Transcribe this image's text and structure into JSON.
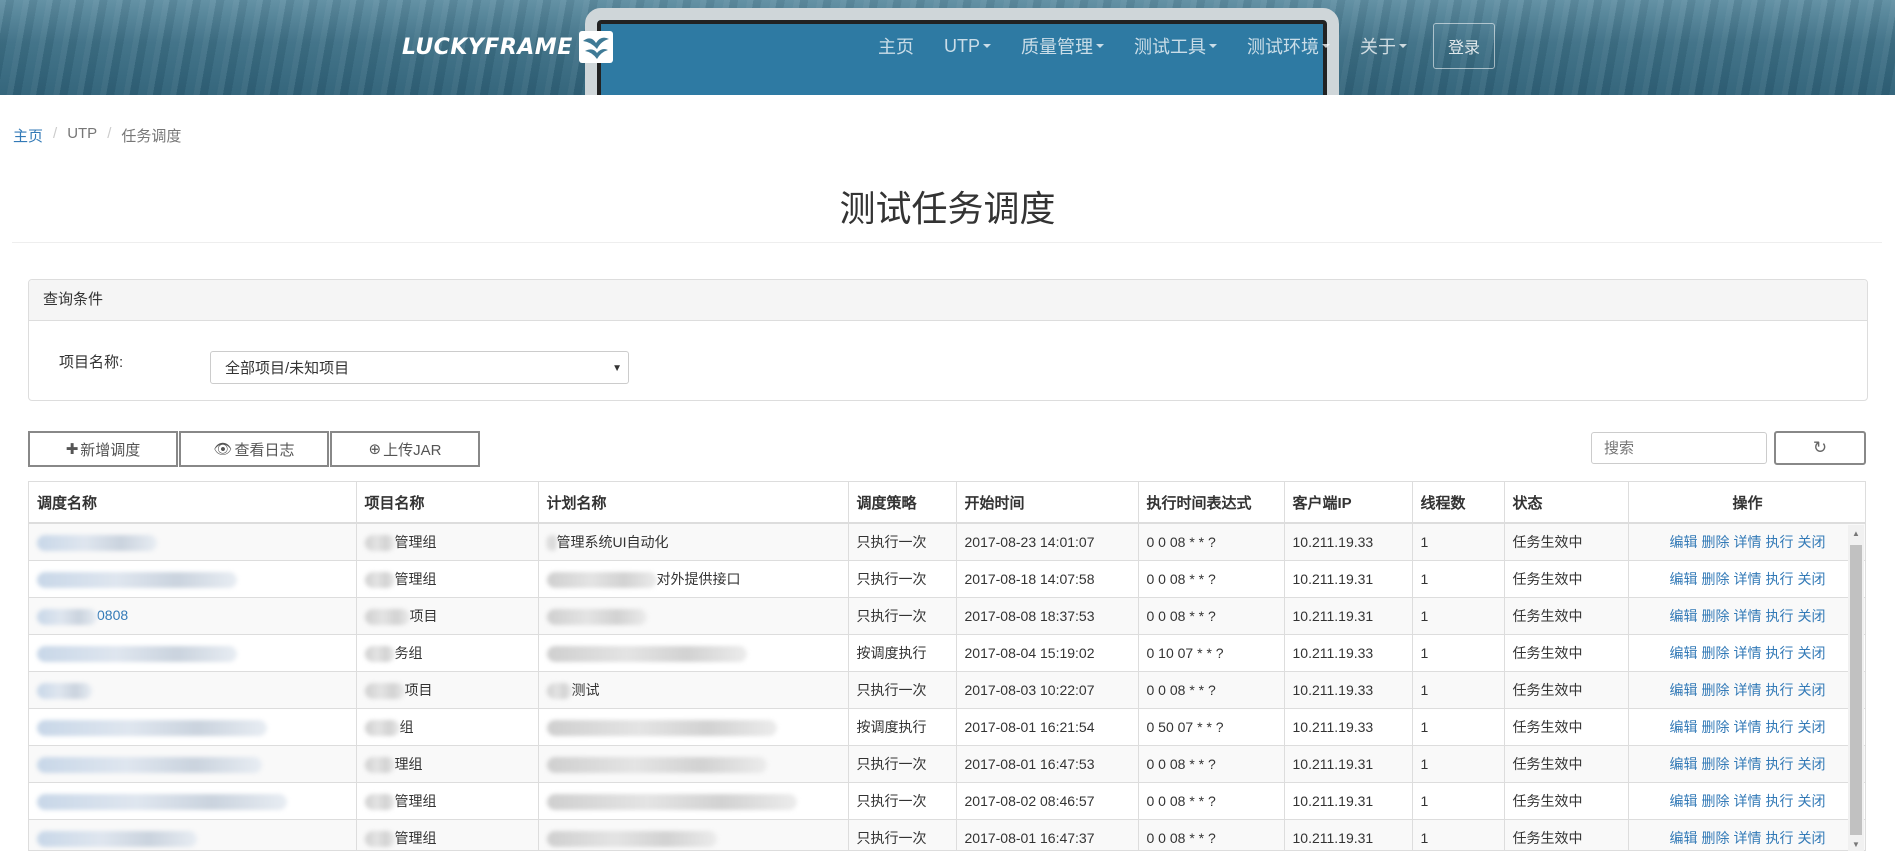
{
  "header": {
    "logo_text": "LUCKYFRAME",
    "nav": [
      {
        "label": "主页",
        "dropdown": false
      },
      {
        "label": "UTP",
        "dropdown": true
      },
      {
        "label": "质量管理",
        "dropdown": true
      },
      {
        "label": "测试工具",
        "dropdown": true
      },
      {
        "label": "测试环境",
        "dropdown": true
      },
      {
        "label": "关于",
        "dropdown": true
      }
    ],
    "login": "登录"
  },
  "breadcrumb": [
    "主页",
    "UTP",
    "任务调度"
  ],
  "page_title": "测试任务调度",
  "query": {
    "panel_title": "查询条件",
    "project_label": "项目名称:",
    "project_value": "全部项目/未知项目"
  },
  "toolbar": {
    "add": "新增调度",
    "log": "查看日志",
    "upload": "上传JAR",
    "search_placeholder": "搜索"
  },
  "table": {
    "columns": [
      "调度名称",
      "项目名称",
      "计划名称",
      "调度策略",
      "开始时间",
      "执行时间表达式",
      "客户端IP",
      "线程数",
      "状态",
      "操作"
    ],
    "actions": [
      "编辑",
      "删除",
      "详情",
      "执行",
      "关闭"
    ],
    "rows": [
      {
        "name": "",
        "project": "管理组",
        "plan": "管理系统UI自动化",
        "strategy": "只执行一次",
        "start": "2017-08-23 14:01:07",
        "cron": "0 0 08 * * ?",
        "ip": "10.211.19.33",
        "threads": "1",
        "status": "任务生效中"
      },
      {
        "name": "",
        "project": "管理组",
        "plan": "对外提供接口",
        "strategy": "只执行一次",
        "start": "2017-08-18 14:07:58",
        "cron": "0 0 08 * * ?",
        "ip": "10.211.19.31",
        "threads": "1",
        "status": "任务生效中"
      },
      {
        "name": "0808",
        "project": "项目",
        "plan": "",
        "strategy": "只执行一次",
        "start": "2017-08-08 18:37:53",
        "cron": "0 0 08 * * ?",
        "ip": "10.211.19.31",
        "threads": "1",
        "status": "任务生效中"
      },
      {
        "name": "",
        "project": "务组",
        "plan": "",
        "strategy": "按调度执行",
        "start": "2017-08-04 15:19:02",
        "cron": "0 10 07 * * ?",
        "ip": "10.211.19.33",
        "threads": "1",
        "status": "任务生效中"
      },
      {
        "name": "",
        "project": "项目",
        "plan": "测试",
        "strategy": "只执行一次",
        "start": "2017-08-03 10:22:07",
        "cron": "0 0 08 * * ?",
        "ip": "10.211.19.33",
        "threads": "1",
        "status": "任务生效中"
      },
      {
        "name": "",
        "project": "组",
        "plan": "",
        "strategy": "按调度执行",
        "start": "2017-08-01 16:21:54",
        "cron": "0 50 07 * * ?",
        "ip": "10.211.19.33",
        "threads": "1",
        "status": "任务生效中"
      },
      {
        "name": "",
        "project": "理组",
        "plan": "",
        "strategy": "只执行一次",
        "start": "2017-08-01 16:47:53",
        "cron": "0 0 08 * * ?",
        "ip": "10.211.19.31",
        "threads": "1",
        "status": "任务生效中"
      },
      {
        "name": "",
        "project": "管理组",
        "plan": "",
        "strategy": "只执行一次",
        "start": "2017-08-02 08:46:57",
        "cron": "0 0 08 * * ?",
        "ip": "10.211.19.31",
        "threads": "1",
        "status": "任务生效中"
      },
      {
        "name": "",
        "project": "管理组",
        "plan": "",
        "strategy": "只执行一次",
        "start": "2017-08-01 16:47:37",
        "cron": "0 0 08 * * ?",
        "ip": "10.211.19.31",
        "threads": "1",
        "status": "任务生效中"
      }
    ]
  }
}
